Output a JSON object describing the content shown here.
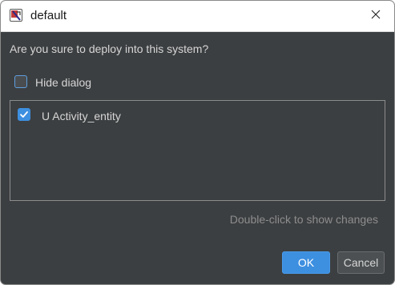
{
  "window": {
    "title": "default",
    "app_icon": "app-icon",
    "close_icon": "close-icon"
  },
  "dialog": {
    "prompt": "Are you sure to deploy into this system?",
    "hide_dialog": {
      "label": "Hide dialog",
      "checked": false
    },
    "items": [
      {
        "label": "U Activity_entity",
        "checked": true
      }
    ],
    "hint": "Double-click to show changes"
  },
  "buttons": {
    "ok": "OK",
    "cancel": "Cancel"
  },
  "colors": {
    "background": "#3c3f41",
    "accent": "#3d8fe0",
    "text": "#d6d6d6",
    "hint": "#8d8d8d"
  }
}
